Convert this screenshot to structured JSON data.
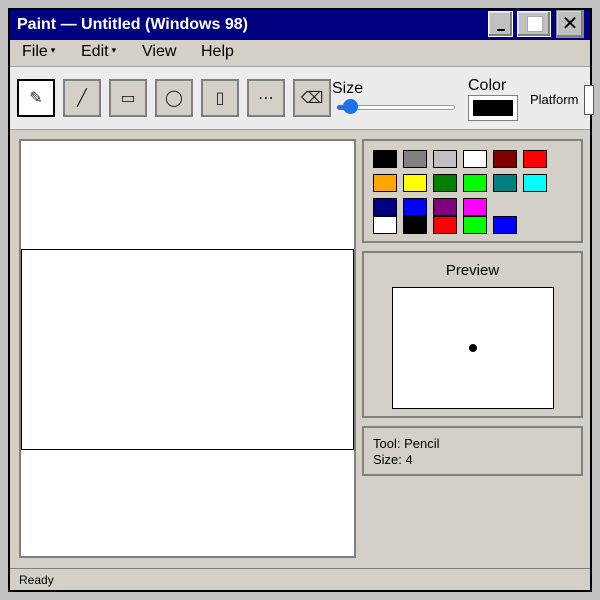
{
  "window": {
    "title": "Paint — Untitled (Windows 98)",
    "close_glyph": "✕"
  },
  "menu": [
    {
      "label": "File",
      "arrow": "▾"
    },
    {
      "label": "Edit",
      "arrow": "▾"
    },
    {
      "label": "View",
      "arrow": ""
    },
    {
      "label": "Help",
      "arrow": ""
    }
  ],
  "tools": [
    {
      "name": "pencil",
      "glyph": "✎",
      "active": true
    },
    {
      "name": "line",
      "glyph": "╱",
      "active": false
    },
    {
      "name": "rectangle",
      "glyph": "▭",
      "active": false
    },
    {
      "name": "ellipse",
      "glyph": "◯",
      "active": false
    },
    {
      "name": "fill",
      "glyph": "▯",
      "active": false
    },
    {
      "name": "more",
      "glyph": "⋯",
      "active": false
    },
    {
      "name": "eraser",
      "glyph": "⌫",
      "active": false
    }
  ],
  "size": {
    "label": "Size",
    "value": 4,
    "min": 1,
    "max": 50
  },
  "color": {
    "label": "Color",
    "current": "#000000"
  },
  "platform": {
    "label": "Platform"
  },
  "palette": [
    [
      "#000000",
      "#808080",
      "#c0c0c0",
      "#ffffff",
      "#800000",
      "#ff0000"
    ],
    [
      "#ffa500",
      "#ffff00",
      "#008000",
      "#00ff00",
      "#008080",
      "#00ffff"
    ],
    [
      "#000080",
      "#0000ff",
      "#800080",
      "#ff00ff"
    ],
    [
      "#ffffff",
      "#000000",
      "#ff0000",
      "#00ff00",
      "#0000ff"
    ]
  ],
  "preview": {
    "title": "Preview"
  },
  "info": {
    "tool": "Tool: Pencil",
    "size": "Size: 4"
  },
  "status": {
    "text": "Ready"
  }
}
